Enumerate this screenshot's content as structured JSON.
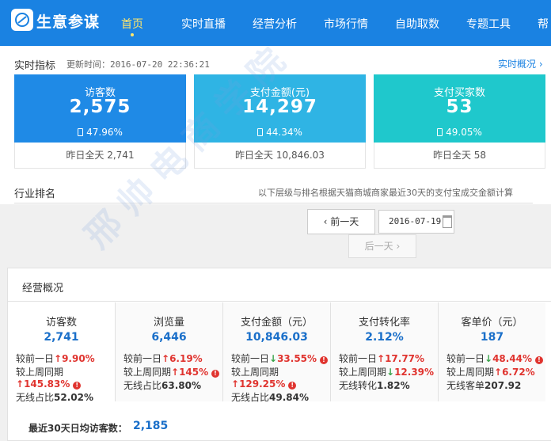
{
  "app": {
    "brand": "生意参谋"
  },
  "nav": [
    "首页",
    "实时直播",
    "经营分析",
    "市场行情",
    "自助取数",
    "专题工具",
    "帮"
  ],
  "realtime": {
    "title": "实时指标",
    "update_time": "更新时间：2016-07-20 22:36:21",
    "more_link": "实时概况 ›",
    "cards": [
      {
        "label": "访客数",
        "value": "2,575",
        "percent": "47.96%",
        "yesterday": "昨日全天  2,741",
        "color": "#1f8ae6"
      },
      {
        "label": "支付金额(元)",
        "value": "14,297",
        "percent": "44.34%",
        "yesterday": "昨日全天  10,846.03",
        "color": "#2fb4e4"
      },
      {
        "label": "支付买家数",
        "value": "53",
        "percent": "49.05%",
        "yesterday": "昨日全天  58",
        "color": "#1fc8cc"
      }
    ],
    "industry_title": "行业排名",
    "industry_note": "以下层级与排名根据天猫商城商家最近30天的支付宝成交金额计算"
  },
  "date_nav": {
    "prev": "前一天",
    "date": "2016-07-19",
    "next": "后一天"
  },
  "overview": {
    "title": "经营概况",
    "columns": [
      {
        "title": "访客数",
        "value": "2,741",
        "l1": "较前一日",
        "l1v": "9.90%",
        "l1dir": "up",
        "l2": "较上周同期",
        "l2v": "145.83%",
        "l2dir": "up",
        "l3": "无线占比",
        "l3v": "52.02%"
      },
      {
        "title": "浏览量",
        "value": "6,446",
        "l1": "较前一日",
        "l1v": "6.19%",
        "l1dir": "up",
        "l2": "较上周同期",
        "l2v": "145%",
        "l2dir": "up",
        "l3": "无线占比",
        "l3v": "63.80%"
      },
      {
        "title": "支付金额（元）",
        "value": "10,846.03",
        "l1": "较前一日",
        "l1v": "33.55%",
        "l1dir": "down",
        "l2": "较上周同期",
        "l2v": "129.25%",
        "l2dir": "up",
        "l3": "无线占比",
        "l3v": "49.84%"
      },
      {
        "title": "支付转化率",
        "value": "2.12%",
        "l1": "较前一日",
        "l1v": "17.77%",
        "l1dir": "up",
        "l2": "较上周同期",
        "l2v": "12.39%",
        "l2dir": "down",
        "l3": "无线转化",
        "l3v": "1.82%"
      },
      {
        "title": "客单价（元）",
        "value": "187",
        "l1": "较前一日",
        "l1v": "48.44%",
        "l1dir": "down",
        "l2": "较上周同期",
        "l2v": "6.72%",
        "l2dir": "up",
        "l3": "无线客单",
        "l3v": "207.92"
      }
    ],
    "avg_label": "最近30天日均访客数：",
    "avg_value": "2,185"
  },
  "watermark": "邢帅电商学院"
}
